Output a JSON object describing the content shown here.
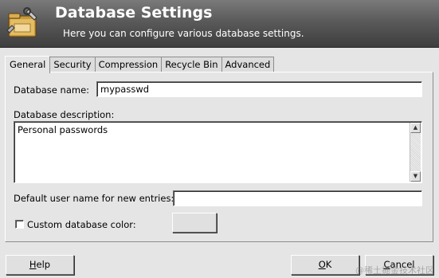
{
  "header": {
    "title": "Database Settings",
    "subtitle": "Here you can configure various database settings.",
    "icon": "database-settings-icon"
  },
  "tabs": [
    {
      "label": "General",
      "active": true
    },
    {
      "label": "Security",
      "active": false
    },
    {
      "label": "Compression",
      "active": false
    },
    {
      "label": "Recycle Bin",
      "active": false
    },
    {
      "label": "Advanced",
      "active": false
    }
  ],
  "general": {
    "db_name_label": "Database name:",
    "db_name_value": "mypasswd",
    "db_description_label": "Database description:",
    "db_description_value": "Personal passwords",
    "default_user_label": "Default user name for new entries:",
    "default_user_value": "",
    "custom_color_label": "Custom database color:",
    "custom_color_checked": false
  },
  "buttons": {
    "help": {
      "label": "Help",
      "mnemonic": "H",
      "rest": "elp"
    },
    "ok": {
      "label": "OK",
      "mnemonic": "O",
      "rest": "K"
    },
    "cancel": {
      "label": "Cancel",
      "mnemonic": "C",
      "rest": "ancel"
    }
  },
  "watermark": "@稀土掘金技术社区",
  "colors": {
    "window_bg": "#e5e5e5",
    "header_dark": "#3e3e3e",
    "header_light": "#7a7a7a",
    "header_text": "#ffffff"
  }
}
